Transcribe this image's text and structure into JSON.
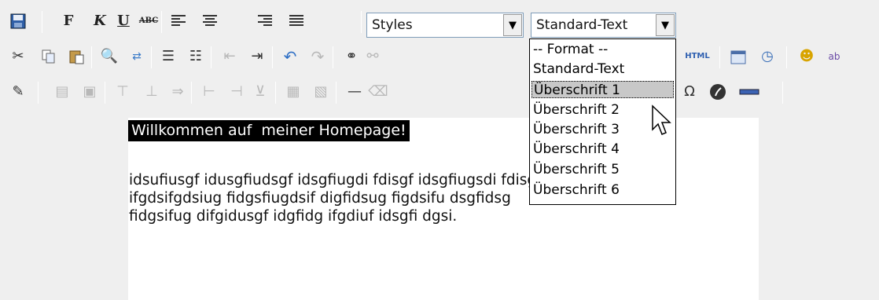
{
  "toolbar": {
    "row1": {
      "bold_label": "F",
      "italic_label": "K",
      "underline_label": "U",
      "strike_label": "ABC",
      "styles_select": {
        "value": "Styles"
      },
      "format_select": {
        "value": "Standard-Text"
      }
    },
    "row2": {
      "html_label": "HTML"
    }
  },
  "format_dropdown": {
    "options": [
      "-- Format --",
      "Standard-Text",
      "Überschrift 1",
      "Überschrift 2",
      "Überschrift 3",
      "Überschrift 4",
      "Überschrift 5",
      "Überschrift 6"
    ],
    "highlighted_index": 2
  },
  "editor": {
    "heading": "Willkommen auf  meiner Homepage!",
    "paragraph_lines": [
      "idsufiusgf idusgfiudsgf idsgfiugdi fdisgf idsgfiugsdi fdisgf",
      "ifgdsifgdsiug fidgsfiugdsif digfidsug figdsifu dsgfidsg",
      "fidgsifug difgidusgf idgfidg ifgdiuf idsgfi dgsi."
    ]
  },
  "icons": {
    "save": "save-icon",
    "cut": "cut-icon",
    "copy": "copy-icon",
    "paste": "paste-icon",
    "find": "find-icon",
    "replace": "replace-icon",
    "bullet_list": "bullet-list-icon",
    "numbered_list": "numbered-list-icon",
    "outdent": "outdent-icon",
    "indent": "indent-icon",
    "undo": "undo-icon",
    "redo": "redo-icon",
    "link": "link-icon",
    "unlink": "unlink-icon",
    "insert_date": "insert-date-icon",
    "insert_time": "insert-time-icon",
    "emoticon": "emoticon-icon",
    "spellcheck": "spellcheck-icon",
    "edit": "edit-icon",
    "horizontal_rule": "horizontal-rule-icon",
    "special_char": "special-char-icon",
    "flash": "flash-icon"
  }
}
